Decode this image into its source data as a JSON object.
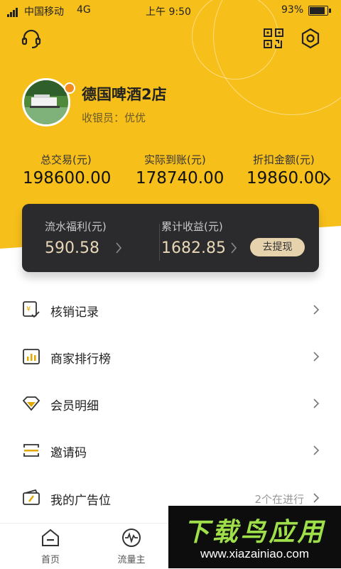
{
  "status_bar": {
    "carrier": "中国移动",
    "network": "4G",
    "time": "上午 9:50",
    "battery_percent": "93%",
    "battery_level": 0.93
  },
  "header": {
    "icons": [
      "headset-icon",
      "qr-code-icon",
      "settings-hex-icon"
    ]
  },
  "profile": {
    "store_name": "德国啤酒2店",
    "cashier_label": "收银员：",
    "cashier_name": "优优"
  },
  "stats": [
    {
      "label": "总交易(元)",
      "value": "198600.00"
    },
    {
      "label": "实际到账(元)",
      "value": "178740.00"
    },
    {
      "label": "折扣金额(元)",
      "value": "19860.00"
    }
  ],
  "earnings_card": {
    "flow_label": "流水福利(元)",
    "flow_value": "590.58",
    "total_label": "累计收益(元)",
    "total_value": "1682.85",
    "withdraw_button": "去提现"
  },
  "menu": [
    {
      "label": "核销记录",
      "icon": "verify-record-icon",
      "extra": ""
    },
    {
      "label": "商家排行榜",
      "icon": "ranking-chart-icon",
      "extra": ""
    },
    {
      "label": "会员明细",
      "icon": "member-diamond-icon",
      "extra": ""
    },
    {
      "label": "邀请码",
      "icon": "invite-code-icon",
      "extra": ""
    },
    {
      "label": "我的广告位",
      "icon": "ad-slot-icon",
      "extra": "2个在进行"
    }
  ],
  "tabs": [
    {
      "label": "首页",
      "icon": "home-icon"
    },
    {
      "label": "流量主",
      "icon": "pulse-icon"
    }
  ],
  "watermark": {
    "title": "下载鸟应用",
    "url": "www.xiazainiao.com"
  },
  "colors": {
    "header_yellow": "#f7bf1a",
    "dark_card": "#2b2b2d",
    "card_gold": "#e8d7b6",
    "avatar_badge": "#f28a1d"
  }
}
